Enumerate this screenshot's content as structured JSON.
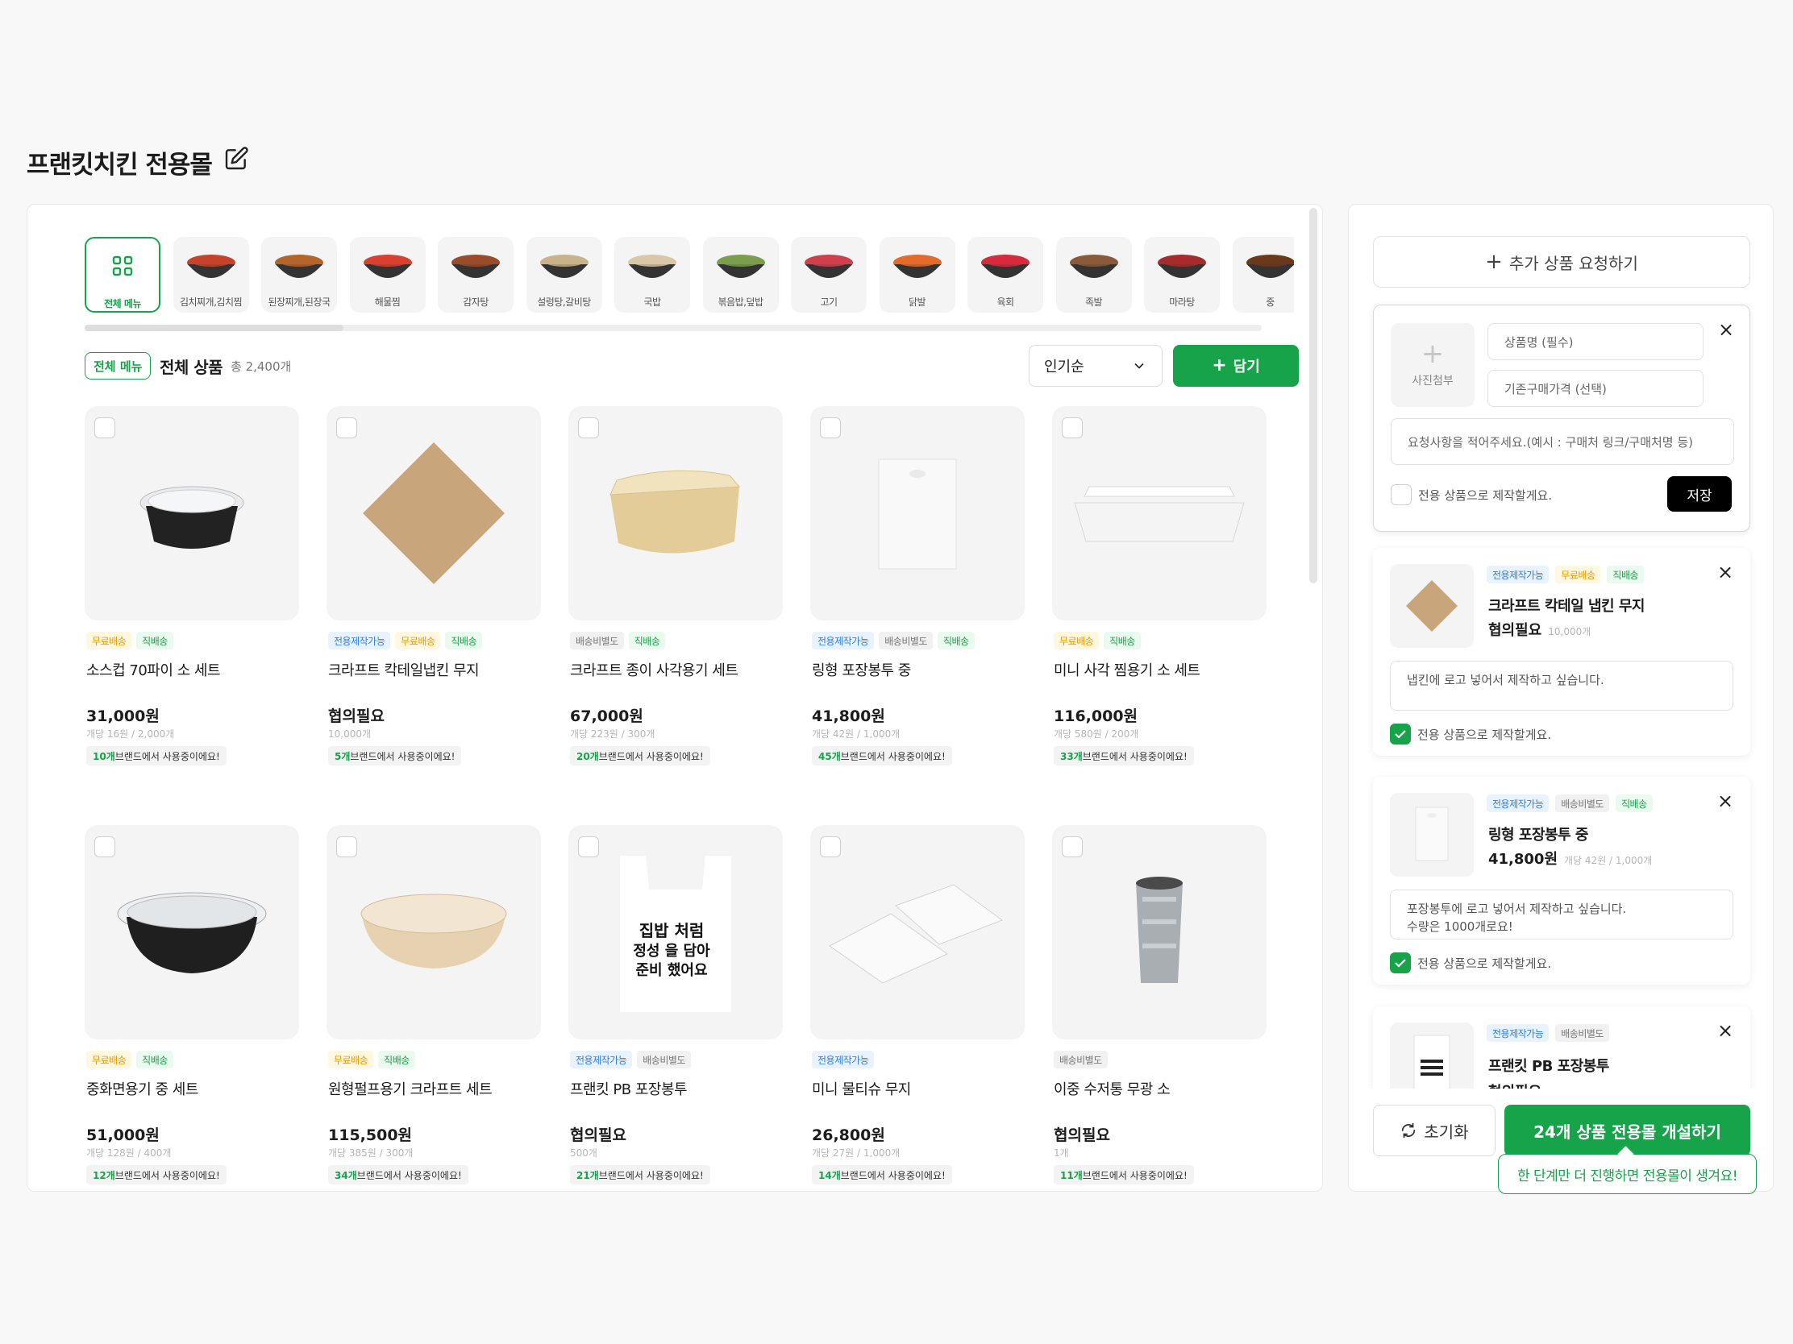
{
  "header": {
    "title": "프랜킷치킨 전용몰"
  },
  "categories": [
    {
      "label": "전체 메뉴",
      "icon": "grid-icon",
      "color": "#16a34a"
    },
    {
      "label": "김치찌개,김치찜",
      "icon": "stew-pot-icon",
      "color": "#c8422b"
    },
    {
      "label": "된장찌개,된장국",
      "icon": "stew-pot-icon",
      "color": "#b5652b"
    },
    {
      "label": "해물찜",
      "icon": "seafood-bowl-icon",
      "color": "#d9402e"
    },
    {
      "label": "감자탕",
      "icon": "stew-pot-icon",
      "color": "#9a4b2b"
    },
    {
      "label": "설렁탕,갈비탕",
      "icon": "soup-bowl-icon",
      "color": "#c9b38a"
    },
    {
      "label": "국밥",
      "icon": "soup-bowl-icon",
      "color": "#d9c7a7"
    },
    {
      "label": "볶음밥,덮밥",
      "icon": "rice-bowl-icon",
      "color": "#7a9e4c"
    },
    {
      "label": "고기",
      "icon": "meat-icon",
      "color": "#d0404c"
    },
    {
      "label": "닭발",
      "icon": "plate-icon",
      "color": "#e36b2b"
    },
    {
      "label": "육회",
      "icon": "plate-icon",
      "color": "#d82a3c"
    },
    {
      "label": "족발",
      "icon": "plate-icon",
      "color": "#8a5a3a"
    },
    {
      "label": "마라탕",
      "icon": "soup-bowl-icon",
      "color": "#a82a2a"
    },
    {
      "label": "중",
      "icon": "stew-pot-icon",
      "color": "#6b3a1a"
    }
  ],
  "category_scroll_fraction": 0.22,
  "filter": {
    "badge": "전체 메뉴",
    "title": "전체 상품",
    "count": "총 2,400개",
    "sort_value": "인기순",
    "add_label": "담기"
  },
  "products": [
    {
      "name": "소스컵 70파이 소 세트",
      "price": "31,000원",
      "unit": "개당 16원 / 2,000개",
      "usage_count": "10개",
      "usage_text": " 브랜드에서 사용중이에요!",
      "tags": [
        {
          "label": "무료배송",
          "type": "free"
        },
        {
          "label": "직배송",
          "type": "direct"
        }
      ],
      "image": "sauce-cup-icon"
    },
    {
      "name": "크라프트 칵테일냅킨 무지",
      "price": "협의필요",
      "unit": "10,000개",
      "usage_count": "5개",
      "usage_text": " 브랜드에서 사용중이에요!",
      "tags": [
        {
          "label": "전용제작가능",
          "type": "custom"
        },
        {
          "label": "무료배송",
          "type": "free"
        },
        {
          "label": "직배송",
          "type": "direct"
        }
      ],
      "image": "napkin-icon"
    },
    {
      "name": "크라프트 종이 사각용기 세트",
      "price": "67,000원",
      "unit": "개당 223원 / 300개",
      "usage_count": "20개",
      "usage_text": " 브랜드에서 사용중이에요!",
      "tags": [
        {
          "label": "배송비별도",
          "type": "ship"
        },
        {
          "label": "직배송",
          "type": "direct"
        }
      ],
      "image": "kraft-box-icon"
    },
    {
      "name": "링형 포장봉투 중",
      "price": "41,800원",
      "unit": "개당 42원 / 1,000개",
      "usage_count": "45개",
      "usage_text": " 브랜드에서 사용중이에요!",
      "tags": [
        {
          "label": "전용제작가능",
          "type": "custom"
        },
        {
          "label": "배송비별도",
          "type": "ship"
        },
        {
          "label": "직배송",
          "type": "direct"
        }
      ],
      "image": "plastic-bag-icon"
    },
    {
      "name": "미니 사각 찜용기 소 세트",
      "price": "116,000원",
      "unit": "개당 580원 / 200개",
      "usage_count": "33개",
      "usage_text": " 브랜드에서 사용중이에요!",
      "tags": [
        {
          "label": "무료배송",
          "type": "free"
        },
        {
          "label": "직배송",
          "type": "direct"
        }
      ],
      "image": "white-tray-icon"
    },
    {
      "name": "중화면용기 중 세트",
      "price": "51,000원",
      "unit": "개당 128원 / 400개",
      "usage_count": "12개",
      "usage_text": " 브랜드에서 사용중이에요!",
      "tags": [
        {
          "label": "무료배송",
          "type": "free"
        },
        {
          "label": "직배송",
          "type": "direct"
        }
      ],
      "image": "black-bowl-icon"
    },
    {
      "name": "원형펄프용기 크라프트 세트",
      "price": "115,500원",
      "unit": "개당 385원 / 300개",
      "usage_count": "34개",
      "usage_text": " 브랜드에서 사용중이에요!",
      "tags": [
        {
          "label": "무료배송",
          "type": "free"
        },
        {
          "label": "직배송",
          "type": "direct"
        }
      ],
      "image": "pulp-bowl-icon"
    },
    {
      "name": "프랜킷 PB 포장봉투",
      "price": "협의필요",
      "unit": "500개",
      "usage_count": "21개",
      "usage_text": " 브랜드에서 사용중이에요!",
      "tags": [
        {
          "label": "전용제작가능",
          "type": "custom"
        },
        {
          "label": "배송비별도",
          "type": "ship"
        }
      ],
      "image": "printed-bag-icon",
      "bag_text": [
        "집밥 처럼",
        "정성 을 담아",
        "준비 했어요"
      ]
    },
    {
      "name": "미니 물티슈 무지",
      "price": "26,800원",
      "unit": "개당 27원 / 1,000개",
      "usage_count": "14개",
      "usage_text": " 브랜드에서 사용중이에요!",
      "tags": [
        {
          "label": "전용제작가능",
          "type": "custom"
        }
      ],
      "image": "wet-tissue-icon"
    },
    {
      "name": "이중 수저통 무광 소",
      "price": "협의필요",
      "unit": "1개",
      "usage_count": "11개",
      "usage_text": " 브랜드에서 사용중이에요!",
      "tags": [
        {
          "label": "배송비별도",
          "type": "ship"
        }
      ],
      "image": "cutlery-tube-icon"
    }
  ],
  "side": {
    "request_label": "추가 상품 요청하기",
    "form": {
      "photo_label": "사진첨부",
      "name_placeholder": "상품명 (필수)",
      "price_placeholder": "기존구매가격 (선택)",
      "note_placeholder": "요청사항을 적어주세요.(예시 : 구매처 링크/구매처명 등)",
      "custom_label": "전용 상품으로 제작할게요.",
      "save_label": "저장"
    },
    "items": [
      {
        "name": "크라프트 칵테일 냅킨 무지",
        "price": "협의필요",
        "price_sub": "10,000개",
        "note": "냅킨에 로고 넣어서 제작하고 싶습니다.",
        "checked": true,
        "custom_label": "전용 상품으로 제작할게요.",
        "tags": [
          {
            "label": "전용제작가능",
            "type": "custom"
          },
          {
            "label": "무료배송",
            "type": "free"
          },
          {
            "label": "직배송",
            "type": "direct"
          }
        ]
      },
      {
        "name": "링형 포장봉투 중",
        "price": "41,800원",
        "price_sub": "개당 42원 / 1,000개",
        "note": "포장봉투에 로고 넣어서 제작하고 싶습니다.\n수량은 1000개로요!",
        "checked": true,
        "custom_label": "전용 상품으로 제작할게요.",
        "tags": [
          {
            "label": "전용제작가능",
            "type": "custom"
          },
          {
            "label": "배송비별도",
            "type": "ship"
          },
          {
            "label": "직배송",
            "type": "direct"
          }
        ]
      },
      {
        "name": "프랜킷 PB 포장봉투",
        "price": "협의필요",
        "tags": [
          {
            "label": "전용제작가능",
            "type": "custom"
          },
          {
            "label": "배송비별도",
            "type": "ship"
          }
        ]
      }
    ],
    "reset_label": "초기화",
    "open_label": "24개 상품 전용몰 개설하기",
    "tooltip": "한 단계만 더 진행하면 전용몰이 생겨요!"
  }
}
